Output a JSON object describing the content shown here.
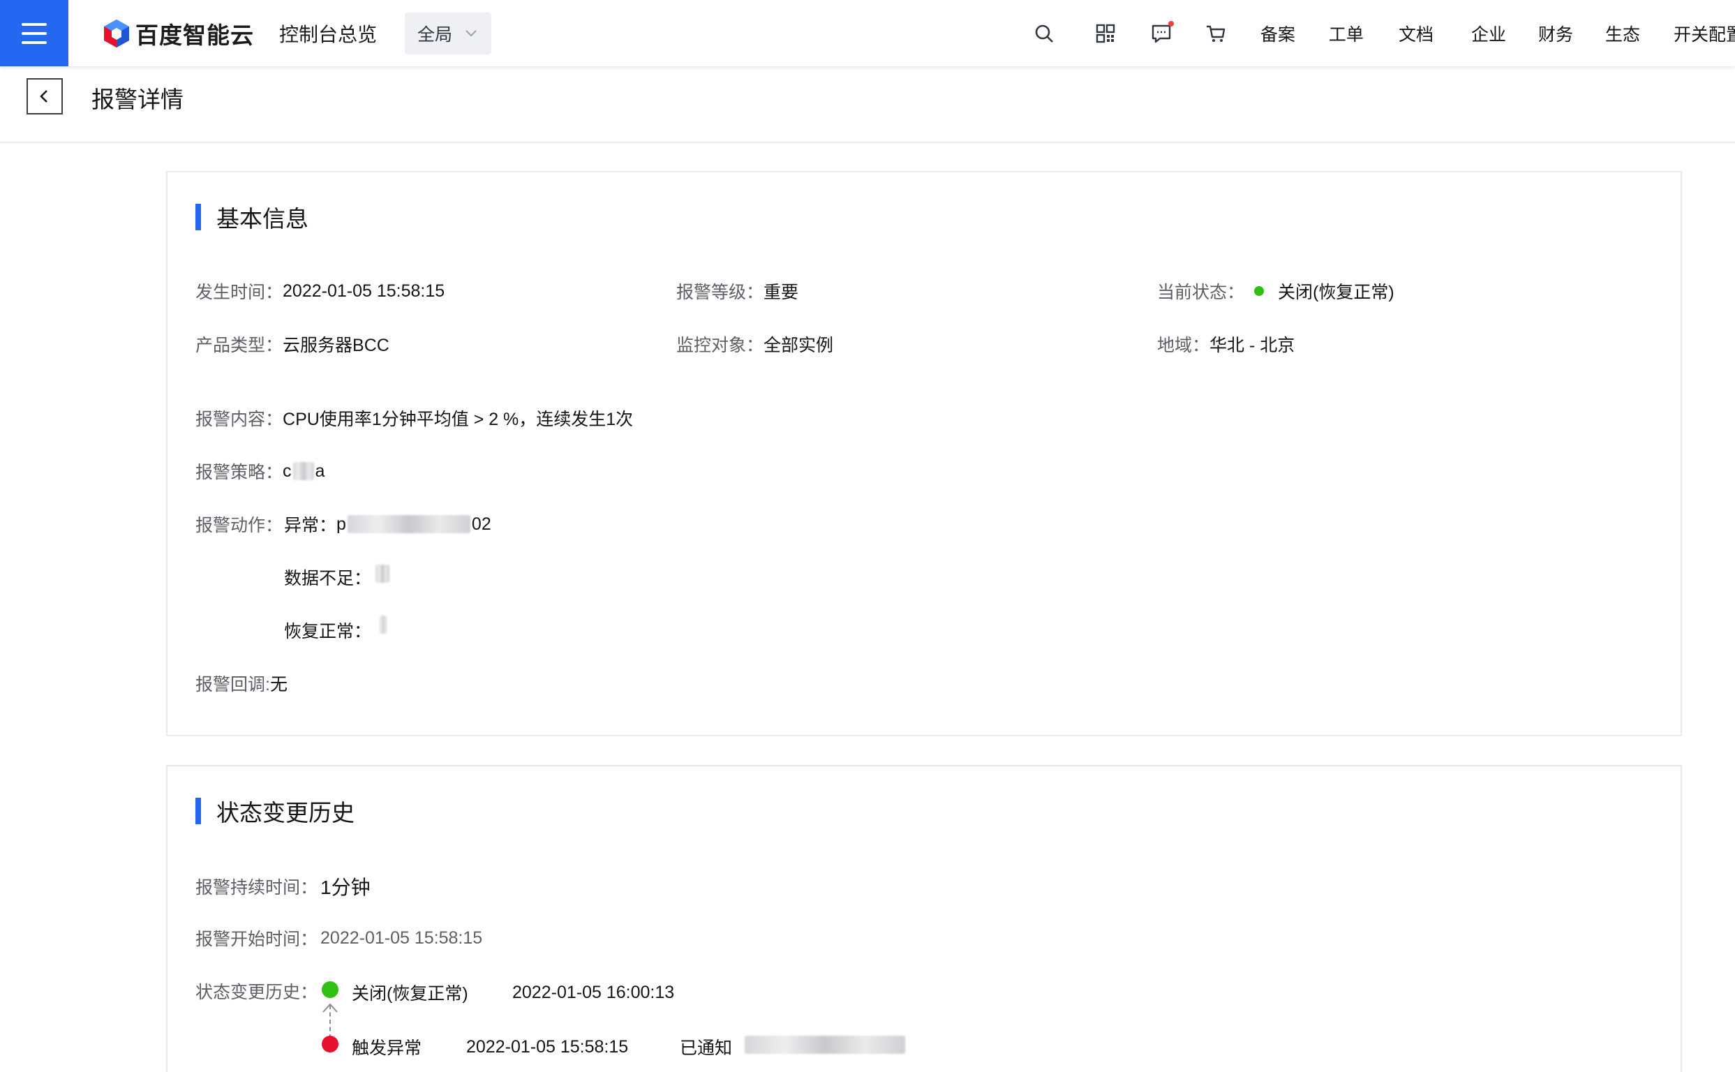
{
  "colors": {
    "accent": "#2468f2",
    "status_ok": "#30bf13",
    "status_alert": "#e8112d",
    "notification_dot": "#f33e3e"
  },
  "header": {
    "menu_icon": "hamburger-icon",
    "brand": "百度智能云",
    "console_link": "控制台总览",
    "scope": {
      "selected": "全局",
      "icon": "chevron-down-icon"
    },
    "icons": [
      "search-icon",
      "grid-apps-icon",
      "message-icon",
      "cart-icon"
    ],
    "nav": [
      "备案",
      "工单",
      "文档",
      "企业",
      "财务",
      "生态",
      "开关配置"
    ]
  },
  "page": {
    "back_icon": "chevron-left-icon",
    "title": "报警详情"
  },
  "basic_info": {
    "title": "基本信息",
    "occur_time": {
      "label": "发生时间：",
      "value": "2022-01-05 15:58:15"
    },
    "level": {
      "label": "报警等级：",
      "value": "重要"
    },
    "status": {
      "label": "当前状态：",
      "value": "关闭(恢复正常)"
    },
    "product": {
      "label": "产品类型：",
      "value": "云服务器BCC"
    },
    "target": {
      "label": "监控对象：",
      "value": "全部实例"
    },
    "region": {
      "label": "地域：",
      "value": "华北 - 北京"
    },
    "content": {
      "label": "报警内容：",
      "value": "CPU使用率1分钟平均值 > 2 %，连续发生1次"
    },
    "policy": {
      "label": "报警策略：",
      "value_prefix": "c",
      "value_suffix": "a"
    },
    "actions": {
      "label": "报警动作：",
      "abnormal": {
        "label": "异常：",
        "value_prefix": "p",
        "value_suffix": "02"
      },
      "insufficient": {
        "label": "数据不足："
      },
      "recovered": {
        "label": "恢复正常："
      }
    },
    "callback": {
      "label": "报警回调: ",
      "value": "无"
    }
  },
  "history": {
    "title": "状态变更历史",
    "duration": {
      "label": "报警持续时间：",
      "value": "1分钟"
    },
    "start_time": {
      "label": "报警开始时间：",
      "value": "2022-01-05 15:58:15"
    },
    "changes_label": "状态变更历史：",
    "events": [
      {
        "state": "关闭(恢复正常)",
        "time": "2022-01-05 16:00:13",
        "note": ""
      },
      {
        "state": "触发异常",
        "time": "2022-01-05 15:58:15",
        "note": "已通知"
      }
    ]
  }
}
